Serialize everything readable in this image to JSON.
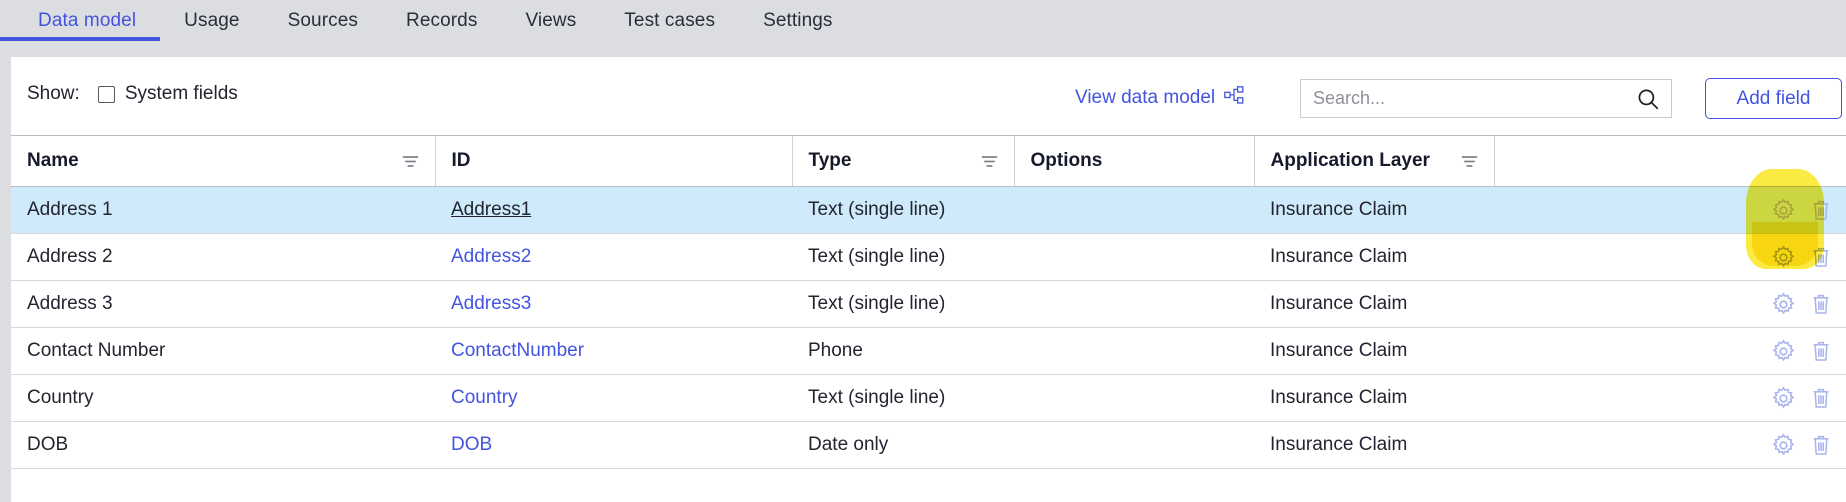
{
  "tabs": [
    {
      "label": "Data model",
      "active": true
    },
    {
      "label": "Usage",
      "active": false
    },
    {
      "label": "Sources",
      "active": false
    },
    {
      "label": "Records",
      "active": false
    },
    {
      "label": "Views",
      "active": false
    },
    {
      "label": "Test cases",
      "active": false
    },
    {
      "label": "Settings",
      "active": false
    }
  ],
  "toolbar": {
    "show_label": "Show:",
    "system_fields_label": "System fields",
    "system_fields_checked": false,
    "view_data_model_label": "View data model",
    "view_data_model_icon": "sitemap-icon",
    "add_field_label": "Add field"
  },
  "search": {
    "value": "",
    "placeholder": "Search...",
    "icon": "search-icon"
  },
  "table": {
    "columns": [
      {
        "label": "Name",
        "filterable": true
      },
      {
        "label": "ID",
        "filterable": false
      },
      {
        "label": "Type",
        "filterable": true
      },
      {
        "label": "Options",
        "filterable": false
      },
      {
        "label": "Application Layer",
        "filterable": true
      },
      {
        "label": "",
        "filterable": false
      }
    ],
    "rows": [
      {
        "name": "Address 1",
        "id": "Address1",
        "type": "Text (single line)",
        "options": "",
        "layer": "Insurance Claim",
        "selected": true,
        "id_underlined": true
      },
      {
        "name": "Address 2",
        "id": "Address2",
        "type": "Text (single line)",
        "options": "",
        "layer": "Insurance Claim",
        "selected": false,
        "id_underlined": false
      },
      {
        "name": "Address 3",
        "id": "Address3",
        "type": "Text (single line)",
        "options": "",
        "layer": "Insurance Claim",
        "selected": false,
        "id_underlined": false
      },
      {
        "name": "Contact Number",
        "id": "ContactNumber",
        "type": "Phone",
        "options": "",
        "layer": "Insurance Claim",
        "selected": false,
        "id_underlined": false
      },
      {
        "name": "Country",
        "id": "Country",
        "type": "Text (single line)",
        "options": "",
        "layer": "Insurance Claim",
        "selected": false,
        "id_underlined": false
      },
      {
        "name": "DOB",
        "id": "DOB",
        "type": "Date only",
        "options": "",
        "layer": "Insurance Claim",
        "selected": false,
        "id_underlined": false
      }
    ],
    "row_actions": [
      {
        "icon": "gear-icon"
      },
      {
        "icon": "trash-icon"
      }
    ]
  },
  "annotation": {
    "highlight_color": "#fbe617",
    "target": "row-settings-gear-icon"
  },
  "colors": {
    "accent": "#4254e0",
    "selected_row": "#cfeafa",
    "chrome": "#dcdde1",
    "icon_blue": "#a8b3ea"
  }
}
